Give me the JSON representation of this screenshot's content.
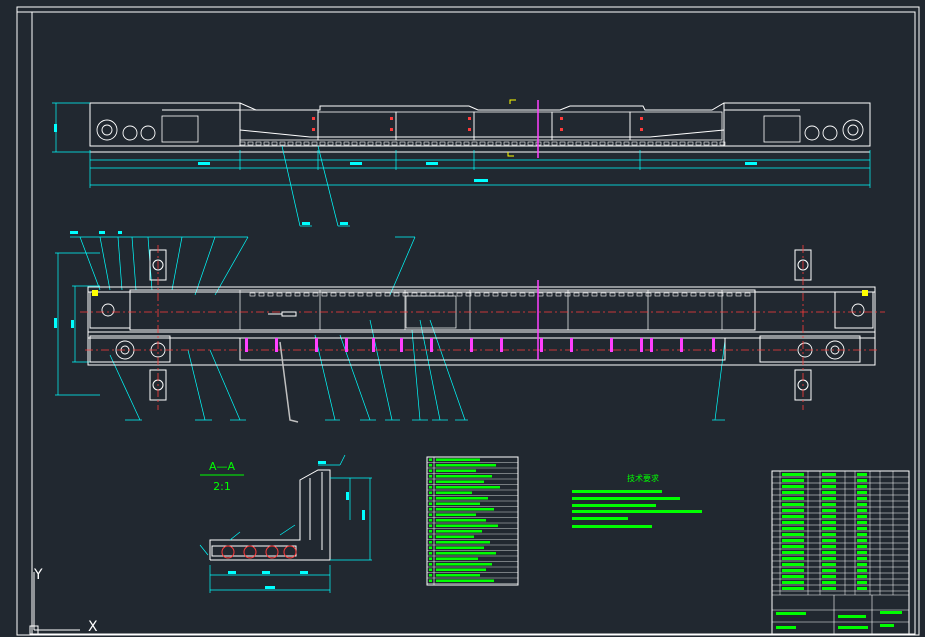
{
  "drawing": {
    "section_label": "A—A",
    "section_scale": "2:1",
    "notes_title": "技术要求",
    "ucs_x_label": "X",
    "ucs_y_label": "Y"
  },
  "colors": {
    "background": "#212830",
    "linework": "#ffffff",
    "dimension": "#00ffff",
    "centerline": "#ff3b3b",
    "text_block": "#00ff00",
    "markers": "#ff40ff",
    "section_mark": "#ffff00"
  }
}
